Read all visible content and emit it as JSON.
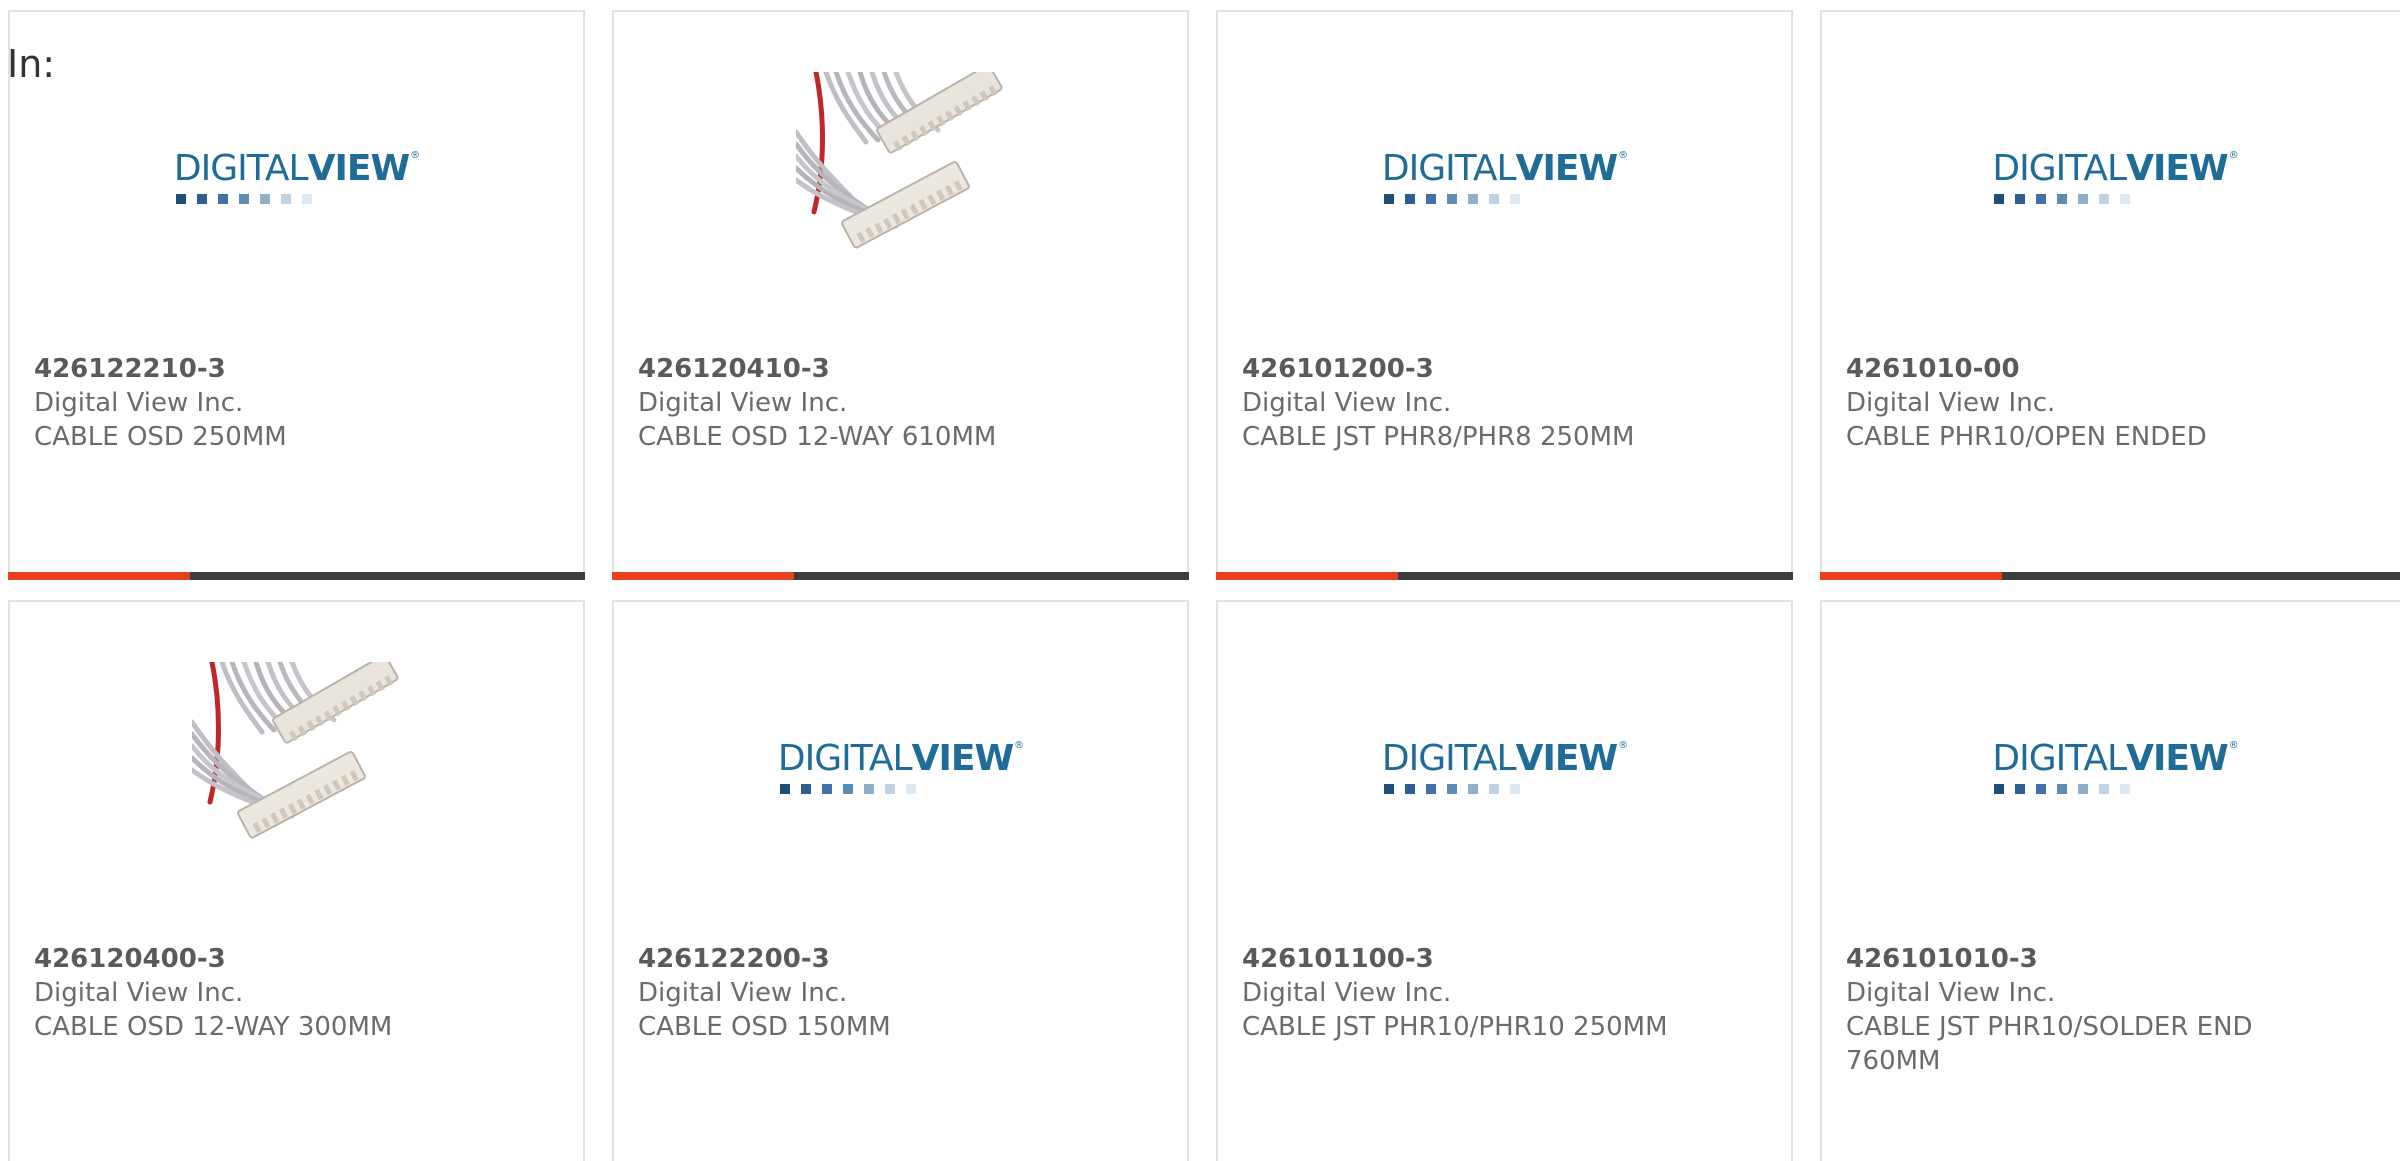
{
  "filter": {
    "label": "In:"
  },
  "logo": {
    "text_light": "DIGITAL",
    "text_bold": "VIEW",
    "registered": "®",
    "square_colors": [
      "#1f4e79",
      "#2a5f8f",
      "#3d74a3",
      "#5b8db5",
      "#8eb0cb",
      "#bfd3e2",
      "#dde8f0"
    ]
  },
  "colors": {
    "accent_bar": "#e8401c",
    "bar_rest": "#3c3c3c",
    "card_border": "#e2e2e2",
    "text": "#6b6b6b"
  },
  "products": [
    {
      "part_number": "426122210-3",
      "manufacturer": "Digital View Inc.",
      "description": "CABLE OSD 250MM",
      "image": "digitalview-logo"
    },
    {
      "part_number": "426120410-3",
      "manufacturer": "Digital View Inc.",
      "description": "CABLE OSD 12-WAY 610MM",
      "image": "cable-photo"
    },
    {
      "part_number": "426101200-3",
      "manufacturer": "Digital View Inc.",
      "description": "CABLE JST PHR8/PHR8 250MM",
      "image": "digitalview-logo"
    },
    {
      "part_number": "4261010-00",
      "manufacturer": "Digital View Inc.",
      "description": "CABLE PHR10/OPEN ENDED",
      "image": "digitalview-logo"
    },
    {
      "part_number": "426120400-3",
      "manufacturer": "Digital View Inc.",
      "description": "CABLE OSD 12-WAY 300MM",
      "image": "cable-photo"
    },
    {
      "part_number": "426122200-3",
      "manufacturer": "Digital View Inc.",
      "description": "CABLE OSD 150MM",
      "image": "digitalview-logo"
    },
    {
      "part_number": "426101100-3",
      "manufacturer": "Digital View Inc.",
      "description": "CABLE JST PHR10/PHR10 250MM",
      "image": "digitalview-logo"
    },
    {
      "part_number": "426101010-3",
      "manufacturer": "Digital View Inc.",
      "description": "CABLE JST PHR10/SOLDER END 760MM",
      "image": "digitalview-logo"
    }
  ]
}
